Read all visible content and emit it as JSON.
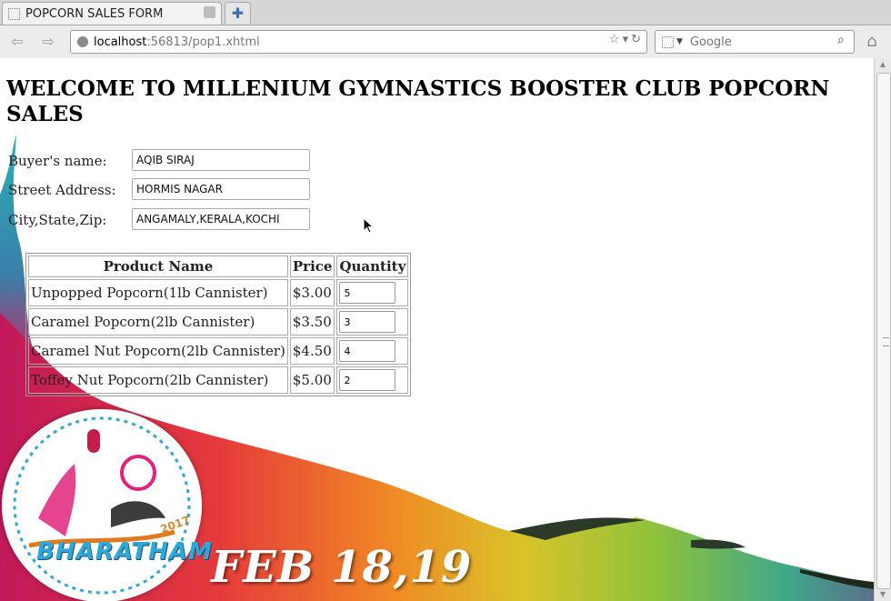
{
  "browser": {
    "tab_title": "POPCORN SALES FORM",
    "url_host": "localhost",
    "url_path": ":56813/pop1.xhtml",
    "search_placeholder": "Google"
  },
  "page": {
    "heading": "WELCOME TO MILLENIUM GYMNASTICS BOOSTER CLUB POPCORN SALES",
    "fields": [
      {
        "label": "Buyer's name:",
        "value": "AQIB SIRAJ"
      },
      {
        "label": "Street Address:",
        "value": "HORMIS NAGAR"
      },
      {
        "label": "City,State,Zip:",
        "value": "ANGAMALY,KERALA,KOCHI"
      }
    ],
    "table": {
      "headers": [
        "Product Name",
        "Price",
        "Quantity"
      ],
      "rows": [
        {
          "product": "Unpopped Popcorn(1lb Cannister)",
          "price": "$3.00",
          "quantity": "5"
        },
        {
          "product": "Caramel Popcorn(2lb Cannister)",
          "price": "$3.50",
          "quantity": "3"
        },
        {
          "product": "Caramel Nut Popcorn(2lb Cannister)",
          "price": "$4.50",
          "quantity": "4"
        },
        {
          "product": "Toffey Nut Popcorn(2lb Cannister)",
          "price": "$5.00",
          "quantity": "2"
        }
      ]
    }
  },
  "banner": {
    "date_text": "FEB 18,19",
    "logo_text": "BHARATHAM",
    "logo_year": "2017"
  },
  "colors": {
    "page_bg": "#ffffff",
    "chrome_bg": "#ececec",
    "logo_blue": "#2ea8d6"
  }
}
